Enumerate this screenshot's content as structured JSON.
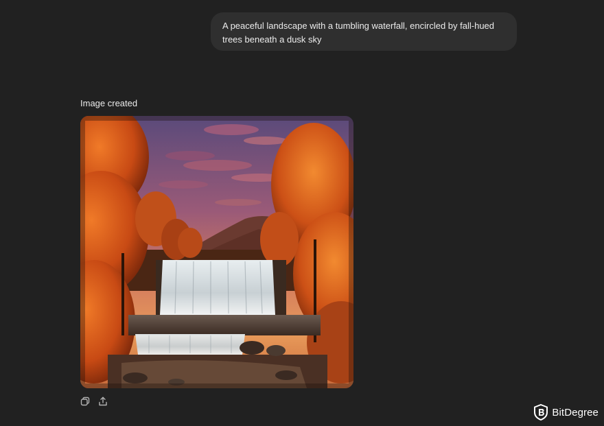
{
  "conversation": {
    "user_prompt": "A peaceful landscape with a tumbling waterfall, encircled by fall-hued trees beneath a dusk sky",
    "assistant_label": "Image created"
  },
  "actions": {
    "copy_icon": "copy-icon",
    "share_icon": "share-icon"
  },
  "watermark": {
    "brand": "BitDegree",
    "logo_icon": "bitdegree-shield-logo"
  },
  "colors": {
    "background": "#212121",
    "bubble": "#2f2f2f",
    "text": "#ececec",
    "icon": "#b4b4b4"
  }
}
